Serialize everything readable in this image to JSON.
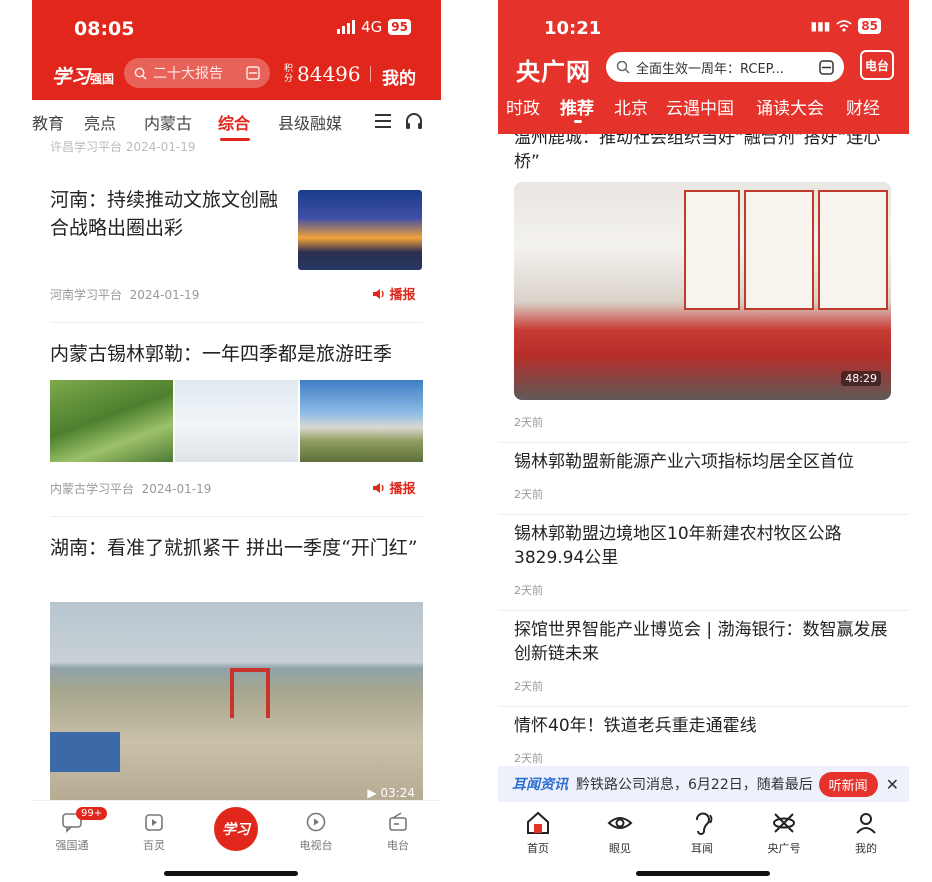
{
  "phone_a": {
    "status": {
      "time": "08:05",
      "network": "4G",
      "battery": "95"
    },
    "header": {
      "logo": "学习",
      "logo_sub": "强国",
      "search_placeholder": "二十大报告",
      "points_label": "积分",
      "points": "84496",
      "mine": "我的"
    },
    "tabs": [
      "教育",
      "亮点",
      "内蒙古",
      "综合",
      "县级融媒"
    ],
    "active_tab": "综合",
    "cut_text": "许昌学习平台 2024-01-19",
    "articles": [
      {
        "title": "河南：持续推动文旅文创融合战略出圈出彩",
        "source": "河南学习平台",
        "date": "2024-01-19",
        "listen": "播报"
      },
      {
        "title": "内蒙古锡林郭勒：一年四季都是旅游旺季",
        "source": "内蒙古学习平台",
        "date": "2024-01-19",
        "listen": "播报"
      },
      {
        "title": "湖南：看准了就抓紧干 拼出一季度“开门红”",
        "duration": "03:24"
      }
    ],
    "bottom_nav": [
      {
        "label": "强国通",
        "badge": "99+"
      },
      {
        "label": "百灵"
      },
      {
        "label": "学习"
      },
      {
        "label": "电视台"
      },
      {
        "label": "电台"
      }
    ]
  },
  "phone_b": {
    "status": {
      "time": "10:21",
      "battery": "85"
    },
    "header": {
      "logo": "央广网",
      "search_placeholder": "全面生效一周年：RCEP...",
      "radio": "电台"
    },
    "tabs": [
      "时政",
      "推荐",
      "北京",
      "云遇中国",
      "诵读大会",
      "财经"
    ],
    "active_tab": "推荐",
    "articles": [
      {
        "title": "温州鹿城：推动社会组织当好“融合剂”搭好“连心桥”",
        "time": "2天前",
        "duration": "48:29"
      },
      {
        "title": "锡林郭勒盟新能源产业六项指标均居全区首位",
        "time": "2天前"
      },
      {
        "title": "锡林郭勒盟边境地区10年新建农村牧区公路3829.94公里",
        "time": "2天前"
      },
      {
        "title": "探馆世界智能产业博览会 | 渤海银行：数智赢发展 创新链未来",
        "time": "2天前"
      },
      {
        "title": "情怀40年！铁道老兵重走通霍线",
        "time": "2天前"
      }
    ],
    "ticker": {
      "brand": "耳闻资讯",
      "message": "黔铁路公司消息，6月22日，随着最后",
      "button": "听新闻"
    },
    "bottom_nav": [
      {
        "label": "首页"
      },
      {
        "label": "眼见"
      },
      {
        "label": "耳闻"
      },
      {
        "label": "央广号"
      },
      {
        "label": "我的"
      }
    ]
  },
  "colors": {
    "xuexi_red": "#e1261b",
    "cnr_red": "#e5322a",
    "ticker_blue": "#2c6fd1"
  }
}
